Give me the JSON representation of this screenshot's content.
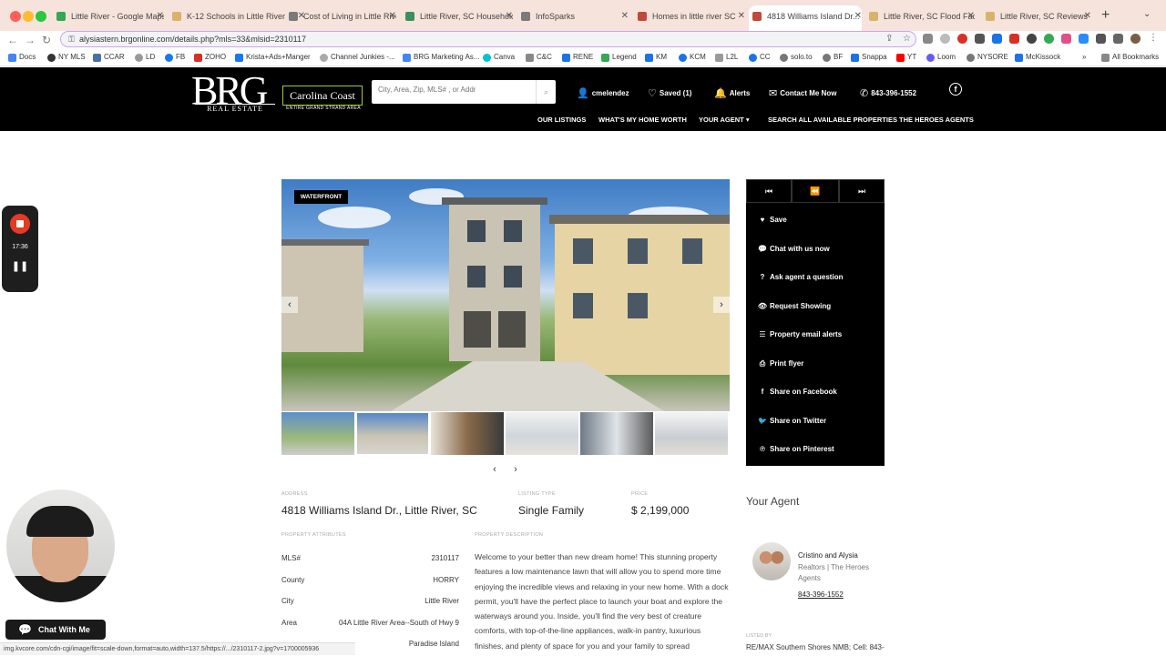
{
  "browser": {
    "tabs": [
      {
        "title": "Little River - Google Maps",
        "color": "#34a853"
      },
      {
        "title": "K-12 Schools in Little River",
        "color": "#d9b36c"
      },
      {
        "title": "Cost of Living in Little River",
        "color": "#7a7a7a"
      },
      {
        "title": "Little River, SC Households",
        "color": "#3a8f5d"
      },
      {
        "title": "InfoSparks",
        "color": "#7a7a7a"
      },
      {
        "title": "Homes in little river SC",
        "color": "#c04a3a"
      },
      {
        "title": "4818 Williams Island Dr...",
        "color": "#c04a3a"
      },
      {
        "title": "Little River, SC Flood Fact",
        "color": "#d9b36c"
      },
      {
        "title": "Little River, SC Reviews",
        "color": "#d9b36c"
      }
    ],
    "url": "alysiastern.brgonline.com/details.php?mls=33&mlsid=2310117",
    "bookmarks": [
      "Docs",
      "NY MLS",
      "CCAR",
      "LD",
      "FB",
      "ZOHO",
      "Krista+Ads+Manger",
      "Channel Junkies -...",
      "BRG Marketing As...",
      "Canva",
      "C&C",
      "RENE",
      "Legend",
      "KM",
      "KCM",
      "L2L",
      "CC",
      "solo.to",
      "BF",
      "Snappa",
      "YT",
      "Loom",
      "NYSORE",
      "McKissock"
    ],
    "all_bookmarks": "All Bookmarks",
    "status_url": "img.kvcore.com/cdn-cgi/image/fit=scale-down,format=auto,width=137.5/https://.../2310117-2.jpg?v=1700005936"
  },
  "header": {
    "logo_main": "BRG",
    "logo_sub": "REAL ESTATE",
    "logo_cc": "Carolina Coast",
    "logo_cc_sub": "ENTIRE GRAND STRAND AREA",
    "search_placeholder": "City, Area, Zip, MLS# , or Addr",
    "user": "cmelendez",
    "saved": "Saved (1)",
    "alerts": "Alerts",
    "contact": "Contact Me Now",
    "phone": "843-396-1552",
    "menu": [
      "OUR LISTINGS",
      "WHAT'S MY HOME WORTH",
      "YOUR AGENT",
      "SEARCH ALL AVAILABLE PROPERTIES",
      "THE HEROES AGENTS"
    ]
  },
  "recorder": {
    "time": "17:36"
  },
  "gallery": {
    "badge": "WATERFRONT"
  },
  "actions": [
    "Save",
    "Chat with us now",
    "Ask agent a question",
    "Request Showing",
    "Property email alerts",
    "Print flyer",
    "Share on Facebook",
    "Share on Twitter",
    "Share on Pinterest"
  ],
  "listing": {
    "address_label": "ADDRESS",
    "address": "4818 Williams Island Dr., Little River, SC",
    "type_label": "LISTING TYPE",
    "type": "Single Family",
    "price_label": "PRICE",
    "price": "$ 2,199,000",
    "attributes_label": "PROPERTY ATTRIBUTES",
    "attributes": [
      {
        "k": "MLS#",
        "v": "2310117"
      },
      {
        "k": "County",
        "v": "HORRY"
      },
      {
        "k": "City",
        "v": "Little River"
      },
      {
        "k": "Area",
        "v": "04A Little River Area--South of Hwy 9"
      },
      {
        "k": "",
        "v": "Paradise Island"
      }
    ],
    "description_label": "PROPERTY DESCRIPTION",
    "description": "Welcome to your better than new dream home! This stunning property features a low maintenance lawn that will allow you to spend more time enjoying the incredible views and relaxing in your new home. With a dock permit, you'll have the perfect place to launch your boat and explore the waterways around you. Inside, you'll find the very best of creature comforts, with top-of-the-line appliances, walk-in pantry, luxurious finishes, and plenty of space for you and your family to spread"
  },
  "agent": {
    "heading": "Your Agent",
    "name": "Cristino and Alysia",
    "role": "Realtors | The Heroes Agents",
    "phone": "843-396-1552",
    "listed_by_label": "LISTED BY",
    "listed_by": "RE/MAX Southern Shores NMB; Cell: 843-"
  },
  "chat_button": "Chat With Me"
}
